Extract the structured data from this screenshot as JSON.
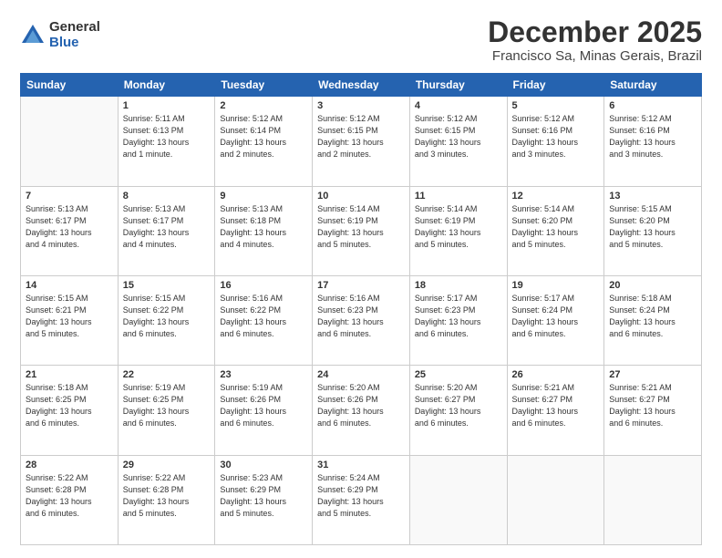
{
  "logo": {
    "general": "General",
    "blue": "Blue"
  },
  "title": "December 2025",
  "location": "Francisco Sa, Minas Gerais, Brazil",
  "days_of_week": [
    "Sunday",
    "Monday",
    "Tuesday",
    "Wednesday",
    "Thursday",
    "Friday",
    "Saturday"
  ],
  "weeks": [
    [
      {
        "day": "",
        "info": ""
      },
      {
        "day": "1",
        "info": "Sunrise: 5:11 AM\nSunset: 6:13 PM\nDaylight: 13 hours\nand 1 minute."
      },
      {
        "day": "2",
        "info": "Sunrise: 5:12 AM\nSunset: 6:14 PM\nDaylight: 13 hours\nand 2 minutes."
      },
      {
        "day": "3",
        "info": "Sunrise: 5:12 AM\nSunset: 6:15 PM\nDaylight: 13 hours\nand 2 minutes."
      },
      {
        "day": "4",
        "info": "Sunrise: 5:12 AM\nSunset: 6:15 PM\nDaylight: 13 hours\nand 3 minutes."
      },
      {
        "day": "5",
        "info": "Sunrise: 5:12 AM\nSunset: 6:16 PM\nDaylight: 13 hours\nand 3 minutes."
      },
      {
        "day": "6",
        "info": "Sunrise: 5:12 AM\nSunset: 6:16 PM\nDaylight: 13 hours\nand 3 minutes."
      }
    ],
    [
      {
        "day": "7",
        "info": "Sunrise: 5:13 AM\nSunset: 6:17 PM\nDaylight: 13 hours\nand 4 minutes."
      },
      {
        "day": "8",
        "info": "Sunrise: 5:13 AM\nSunset: 6:17 PM\nDaylight: 13 hours\nand 4 minutes."
      },
      {
        "day": "9",
        "info": "Sunrise: 5:13 AM\nSunset: 6:18 PM\nDaylight: 13 hours\nand 4 minutes."
      },
      {
        "day": "10",
        "info": "Sunrise: 5:14 AM\nSunset: 6:19 PM\nDaylight: 13 hours\nand 5 minutes."
      },
      {
        "day": "11",
        "info": "Sunrise: 5:14 AM\nSunset: 6:19 PM\nDaylight: 13 hours\nand 5 minutes."
      },
      {
        "day": "12",
        "info": "Sunrise: 5:14 AM\nSunset: 6:20 PM\nDaylight: 13 hours\nand 5 minutes."
      },
      {
        "day": "13",
        "info": "Sunrise: 5:15 AM\nSunset: 6:20 PM\nDaylight: 13 hours\nand 5 minutes."
      }
    ],
    [
      {
        "day": "14",
        "info": "Sunrise: 5:15 AM\nSunset: 6:21 PM\nDaylight: 13 hours\nand 5 minutes."
      },
      {
        "day": "15",
        "info": "Sunrise: 5:15 AM\nSunset: 6:22 PM\nDaylight: 13 hours\nand 6 minutes."
      },
      {
        "day": "16",
        "info": "Sunrise: 5:16 AM\nSunset: 6:22 PM\nDaylight: 13 hours\nand 6 minutes."
      },
      {
        "day": "17",
        "info": "Sunrise: 5:16 AM\nSunset: 6:23 PM\nDaylight: 13 hours\nand 6 minutes."
      },
      {
        "day": "18",
        "info": "Sunrise: 5:17 AM\nSunset: 6:23 PM\nDaylight: 13 hours\nand 6 minutes."
      },
      {
        "day": "19",
        "info": "Sunrise: 5:17 AM\nSunset: 6:24 PM\nDaylight: 13 hours\nand 6 minutes."
      },
      {
        "day": "20",
        "info": "Sunrise: 5:18 AM\nSunset: 6:24 PM\nDaylight: 13 hours\nand 6 minutes."
      }
    ],
    [
      {
        "day": "21",
        "info": "Sunrise: 5:18 AM\nSunset: 6:25 PM\nDaylight: 13 hours\nand 6 minutes."
      },
      {
        "day": "22",
        "info": "Sunrise: 5:19 AM\nSunset: 6:25 PM\nDaylight: 13 hours\nand 6 minutes."
      },
      {
        "day": "23",
        "info": "Sunrise: 5:19 AM\nSunset: 6:26 PM\nDaylight: 13 hours\nand 6 minutes."
      },
      {
        "day": "24",
        "info": "Sunrise: 5:20 AM\nSunset: 6:26 PM\nDaylight: 13 hours\nand 6 minutes."
      },
      {
        "day": "25",
        "info": "Sunrise: 5:20 AM\nSunset: 6:27 PM\nDaylight: 13 hours\nand 6 minutes."
      },
      {
        "day": "26",
        "info": "Sunrise: 5:21 AM\nSunset: 6:27 PM\nDaylight: 13 hours\nand 6 minutes."
      },
      {
        "day": "27",
        "info": "Sunrise: 5:21 AM\nSunset: 6:27 PM\nDaylight: 13 hours\nand 6 minutes."
      }
    ],
    [
      {
        "day": "28",
        "info": "Sunrise: 5:22 AM\nSunset: 6:28 PM\nDaylight: 13 hours\nand 6 minutes."
      },
      {
        "day": "29",
        "info": "Sunrise: 5:22 AM\nSunset: 6:28 PM\nDaylight: 13 hours\nand 5 minutes."
      },
      {
        "day": "30",
        "info": "Sunrise: 5:23 AM\nSunset: 6:29 PM\nDaylight: 13 hours\nand 5 minutes."
      },
      {
        "day": "31",
        "info": "Sunrise: 5:24 AM\nSunset: 6:29 PM\nDaylight: 13 hours\nand 5 minutes."
      },
      {
        "day": "",
        "info": ""
      },
      {
        "day": "",
        "info": ""
      },
      {
        "day": "",
        "info": ""
      }
    ]
  ]
}
